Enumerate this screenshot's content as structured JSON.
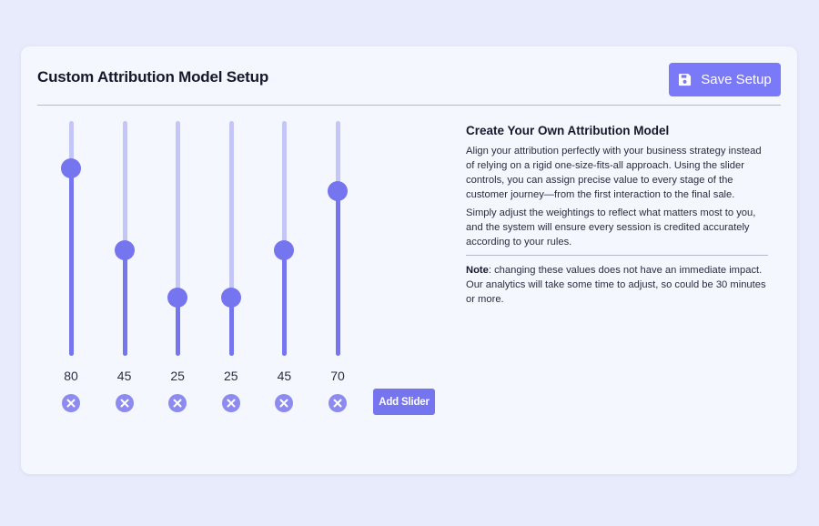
{
  "header": {
    "title": "Custom Attribution Model Setup",
    "save_label": "Save Setup",
    "save_icon": "floppy-disk-icon"
  },
  "sliders": [
    {
      "value": 80,
      "label": "80"
    },
    {
      "value": 45,
      "label": "45"
    },
    {
      "value": 25,
      "label": "25"
    },
    {
      "value": 25,
      "label": "25"
    },
    {
      "value": 45,
      "label": "45"
    },
    {
      "value": 70,
      "label": "70"
    }
  ],
  "slider_range": [
    0,
    100
  ],
  "add_slider_label": "Add Slider",
  "info": {
    "heading": "Create Your Own Attribution Model",
    "paragraph1": "Align your attribution perfectly with your business strategy instead of relying on a rigid one-size-fits-all approach. Using the slider controls, you can assign precise value to every stage of the customer journey—from the first interaction to the final sale.",
    "paragraph2": "Simply adjust the weightings to reflect what matters most to you, and the system will ensure every session is credited accurately according to your rules.",
    "note_label": "Note",
    "note_text": ": changing these values does not have an immediate impact. Our analytics will take some time to adjust, so could be 30 minutes or more."
  },
  "colors": {
    "accent": "#7575f0",
    "track": "#c3c6f6",
    "background": "#e8ebfb",
    "card": "#f5f7fe"
  }
}
